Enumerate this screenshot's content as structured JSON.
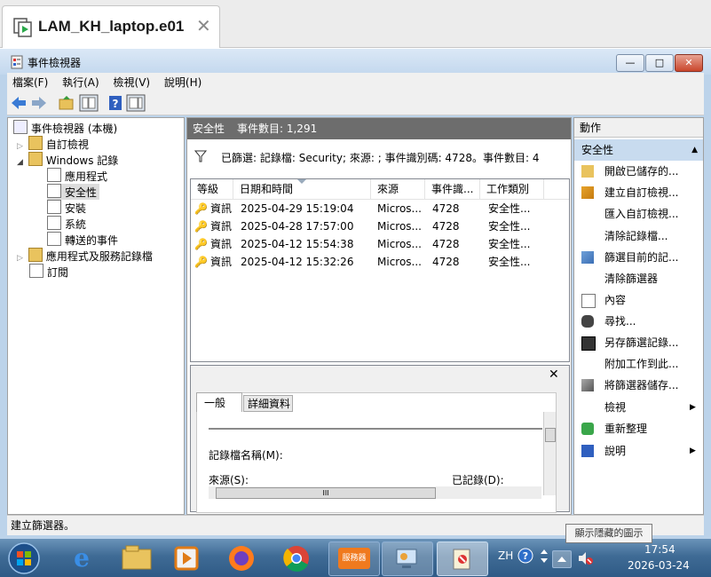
{
  "host_tab": {
    "title": "LAM_KH_laptop.e01",
    "close": "✕"
  },
  "window": {
    "title": "事件檢視器",
    "min": "—",
    "max": "□",
    "close": "✕"
  },
  "menu": [
    "檔案(F)",
    "執行(A)",
    "檢視(V)",
    "說明(H)"
  ],
  "tree": {
    "root": "事件檢視器 (本機)",
    "custom_views": "自訂檢視",
    "windows_logs": "Windows 記錄",
    "logs": [
      "應用程式",
      "安全性",
      "安裝",
      "系統",
      "轉送的事件"
    ],
    "app_services": "應用程式及服務記錄檔",
    "subscriptions": "訂閱"
  },
  "center": {
    "header_name": "安全性",
    "header_count": "事件數目: 1,291",
    "filter_text": "已篩選: 記錄檔: Security; 來源: ; 事件識別碼: 4728。事件數目: 4",
    "columns": [
      "等級",
      "日期和時間",
      "來源",
      "事件識...",
      "工作類別"
    ],
    "rows": [
      [
        "資訊",
        "2025-04-29 15:19:04",
        "Micros...",
        "4728",
        "安全性..."
      ],
      [
        "資訊",
        "2025-04-28 17:57:00",
        "Micros...",
        "4728",
        "安全性..."
      ],
      [
        "資訊",
        "2025-04-12 15:54:38",
        "Micros...",
        "4728",
        "安全性..."
      ],
      [
        "資訊",
        "2025-04-12 15:32:26",
        "Micros...",
        "4728",
        "安全性..."
      ]
    ],
    "detail_close": "✕",
    "detail_tabs": [
      "一般",
      "詳細資料"
    ],
    "detail_fields": {
      "log_name": "記錄檔名稱(M):",
      "source": "來源(S):",
      "logged": "已記錄(D):"
    },
    "scroll_grip": "III"
  },
  "actions": {
    "header": "動作",
    "section": "安全性",
    "items": [
      "開啟已儲存的...",
      "建立自訂檢視...",
      "匯入自訂檢視...",
      "清除記錄檔...",
      "篩選目前的記...",
      "清除篩選器",
      "內容",
      "尋找...",
      "另存篩選記錄...",
      "附加工作到此...",
      "將篩選器儲存...",
      "檢視",
      "重新整理",
      "說明"
    ]
  },
  "status": "建立篩選器。",
  "taskbar": {
    "server_label": "服務器",
    "lang": "ZH",
    "time": "17:54",
    "date": "2026-03-24",
    "tooltip": "顯示隱藏的圖示"
  }
}
